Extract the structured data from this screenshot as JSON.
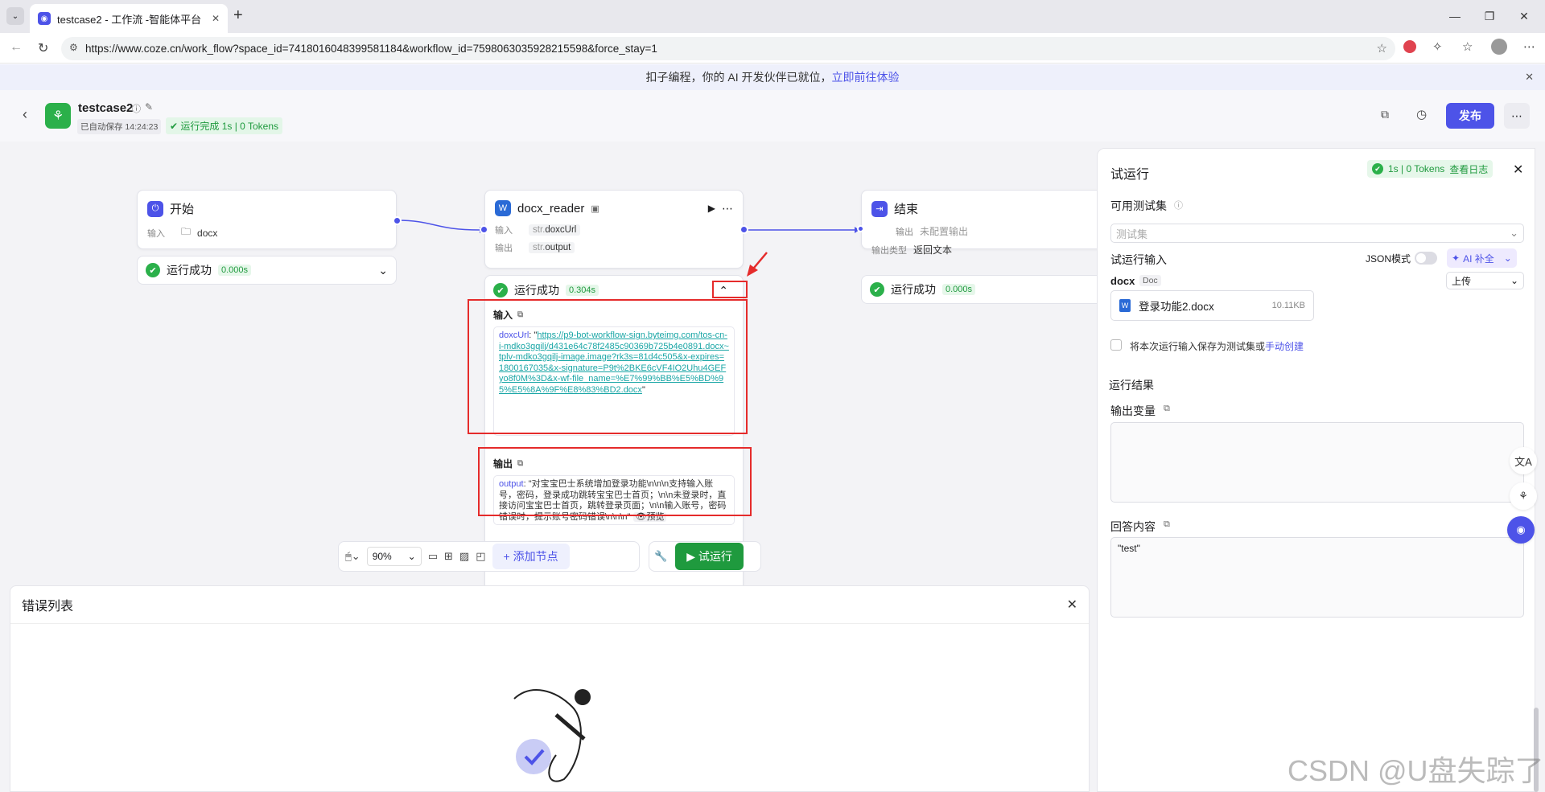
{
  "browser": {
    "tab_title": "testcase2 - 工作流 -智能体平台",
    "new_tab": "+",
    "url": "https://www.coze.cn/work_flow?space_id=7418016048399581184&workflow_id=7598063035928215598&force_stay=1"
  },
  "banner": {
    "text": "扣子编程，你的 AI 开发伙伴已就位，",
    "link": "立即前往体验"
  },
  "header": {
    "title": "testcase2",
    "autosave": "已自动保存 14:24:23",
    "run_status": "运行完成 1s | 0 Tokens",
    "publish": "发布"
  },
  "nodes": {
    "start": {
      "title": "开始",
      "input_label": "输入",
      "input_value": "docx",
      "status": "运行成功",
      "time": "0.000s"
    },
    "docx": {
      "title": "docx_reader",
      "input_label": "输入",
      "input_type": "str.",
      "input_value": "doxcUrl",
      "output_label": "输出",
      "output_type": "str.",
      "output_value": "output",
      "status": "运行成功",
      "time": "0.304s",
      "input_section": "输入",
      "input_key": "doxcUrl",
      "input_url": "https://p9-bot-workflow-sign.byteimg.com/tos-cn-i-mdko3gqilj/d431e64c78f2485c90369b725b4e0891.docx~tplv-mdko3gqilj-image.image?rk3s=81d4c505&x-expires=1800167035&x-signature=P9t%2BKE6cVF4IO2Uhu4GEFyo8f0M%3D&x-wf-file_name=%E7%99%BB%E5%BD%95%E5%8A%9F%E8%83%BD2.docx",
      "output_section": "输出",
      "output_key": "output",
      "output_text": "对宝宝巴士系统增加登录功能\\n\\n\\n支持输入账号，密码，登录成功跳转宝宝巴士首页；\\n\\n未登录时，直接访问宝宝巴士首页，跳转登录页面；\\n\\n输入账号，密码错误时，提示账号密码错误\\n\\n\\n",
      "preview": "预览"
    },
    "end": {
      "title": "结束",
      "output_label": "输出",
      "output_value": "未配置输出",
      "type_label": "输出类型",
      "type_value": "返回文本",
      "status": "运行成功",
      "time": "0.000s"
    }
  },
  "toolbar": {
    "zoom": "90%",
    "add_node": "添加节点",
    "run": "试运行"
  },
  "error_panel": {
    "title": "错误列表"
  },
  "test_panel": {
    "title": "试运行",
    "tokens": "1s | 0 Tokens",
    "view_log": "查看日志",
    "testset_label": "可用测试集",
    "testset_placeholder": "测试集",
    "input_label": "试运行输入",
    "json_mode": "JSON模式",
    "ai_fill": "AI 补全",
    "param_name": "docx",
    "param_type": "Doc",
    "upload_select": "上传",
    "file_name": "登录功能2.docx",
    "file_size": "10.11KB",
    "save_checkbox": "将本次运行输入保存为测试集或",
    "manual_create": "手动创建",
    "result_label": "运行结果",
    "output_var_label": "输出变量",
    "answer_label": "回答内容",
    "answer_value": "\"test\""
  },
  "watermark": "CSDN @U盘失踪了",
  "colors": {
    "accent": "#4d53e8",
    "success": "#1f9a3e",
    "highlight": "#e52b2b"
  }
}
